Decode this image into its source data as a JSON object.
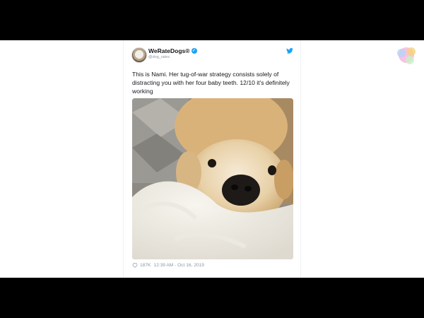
{
  "tweet": {
    "display_name": "WeRateDogs®",
    "handle": "@dog_rates",
    "text": "This is Nami. Her tug-of-war strategy consists solely of distracting you with her four baby teeth. 12/10 it's definitely working",
    "likes": "187K",
    "time": "12:39 AM - Oct 16, 2019",
    "verified_icon": "verified-badge-icon",
    "bird_icon": "twitter-bird-icon",
    "heart_icon": "heart-icon"
  },
  "colors": {
    "accent": "#1da1f2",
    "text": "#14171a",
    "muted": "#8899a6"
  }
}
